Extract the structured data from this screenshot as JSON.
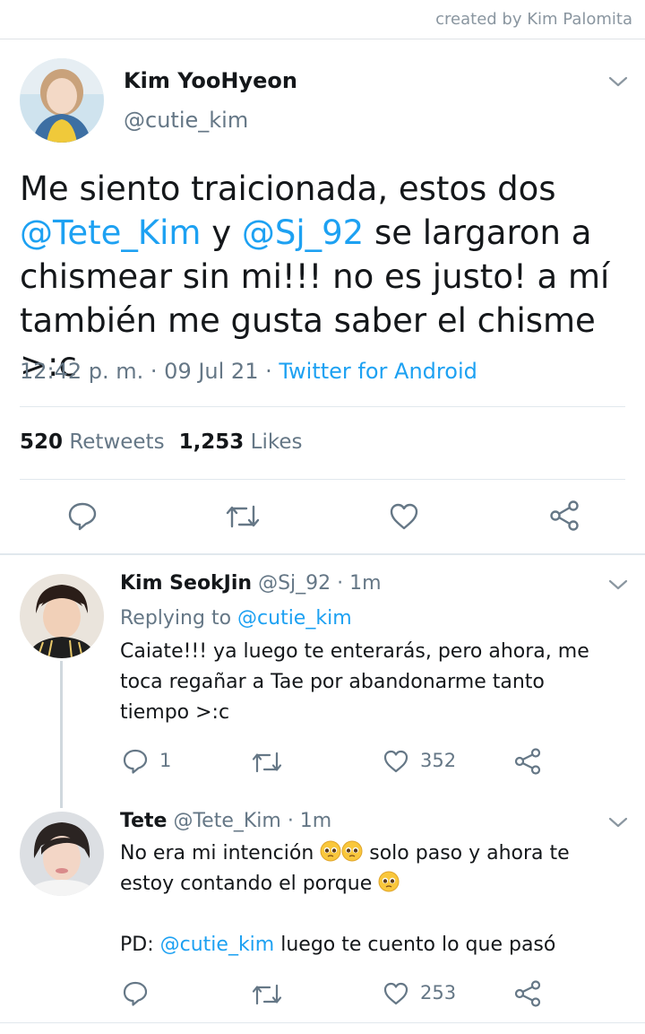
{
  "credit": "created by Kim Palomita",
  "main_tweet": {
    "name": "Kim YooHyeon",
    "handle": "@cutie_kim",
    "text_part1": "Me siento traicionada, estos dos ",
    "mention1": "@Tete_Kim",
    "text_part2": " y ",
    "mention2": "@Sj_92",
    "text_part3": "  se largaron a chismear sin mi!!! no es justo! a mí también me gusta saber el chisme >:c",
    "time": "12:42 p. m. · 09 Jul 21 · ",
    "client": "Twitter for Android",
    "retweets_count": "520",
    "retweets_label": "Retweets",
    "likes_count": "1,253",
    "likes_label": "Likes",
    "icons": [
      "reply-icon",
      "retweet-icon",
      "like-icon",
      "share-icon"
    ]
  },
  "replies": [
    {
      "name": "Kim SeokJin",
      "handle_time": "@Sj_92 · 1m",
      "replying_label": "Replying to ",
      "replying_to": "@cutie_kim",
      "text": "Caiate!!! ya luego te enterarás, pero ahora, me toca regañar a Tae por abandonarme tanto tiempo >:c",
      "reply_count": "1",
      "like_count": "352"
    },
    {
      "name": "Tete",
      "handle_time": "@Tete_Kim · 1m",
      "text_line1_a": "No era mi intención ",
      "text_line1_b": " solo paso y ahora te",
      "text_line2": "estoy contando el porque ",
      "text_pd_label": "PD: ",
      "text_pd_mention": "@cutie_kim",
      "text_pd_rest": " luego te cuento lo que pasó",
      "emoji": "pleading-face",
      "like_count": "253"
    }
  ],
  "colors": {
    "accent": "#1da1f2",
    "secondary_text": "#657786",
    "primary_text": "#14171a"
  }
}
